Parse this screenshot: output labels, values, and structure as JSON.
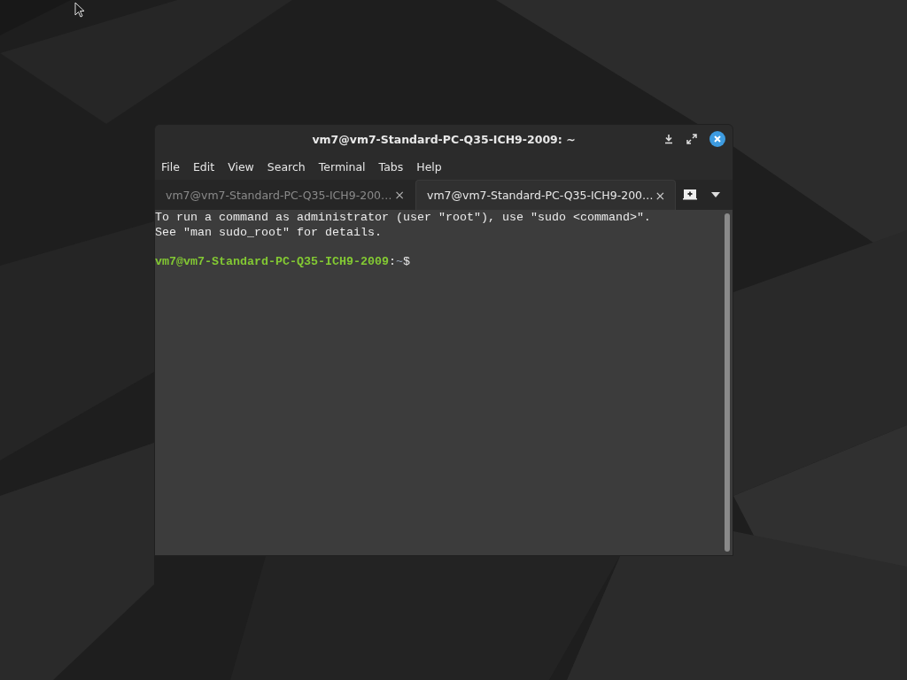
{
  "window": {
    "title": "vm7@vm7-Standard-PC-Q35-ICH9-2009: ~"
  },
  "menu": [
    "File",
    "Edit",
    "View",
    "Search",
    "Terminal",
    "Tabs",
    "Help"
  ],
  "tabs": [
    {
      "label": "vm7@vm7-Standard-PC-Q35-ICH9-200…",
      "close": "×",
      "selected": false
    },
    {
      "label": "vm7@vm7-Standard-PC-Q35-ICH9-200…",
      "close": "×",
      "selected": true
    }
  ],
  "terminal": {
    "lines": [
      "To run a command as administrator (user \"root\"), use \"sudo <command>\".",
      "See \"man sudo_root\" for details."
    ],
    "prompt": {
      "user_host": "vm7@vm7-Standard-PC-Q35-ICH9-2009",
      "separator": ":",
      "path": "~",
      "symbol": "$"
    }
  }
}
